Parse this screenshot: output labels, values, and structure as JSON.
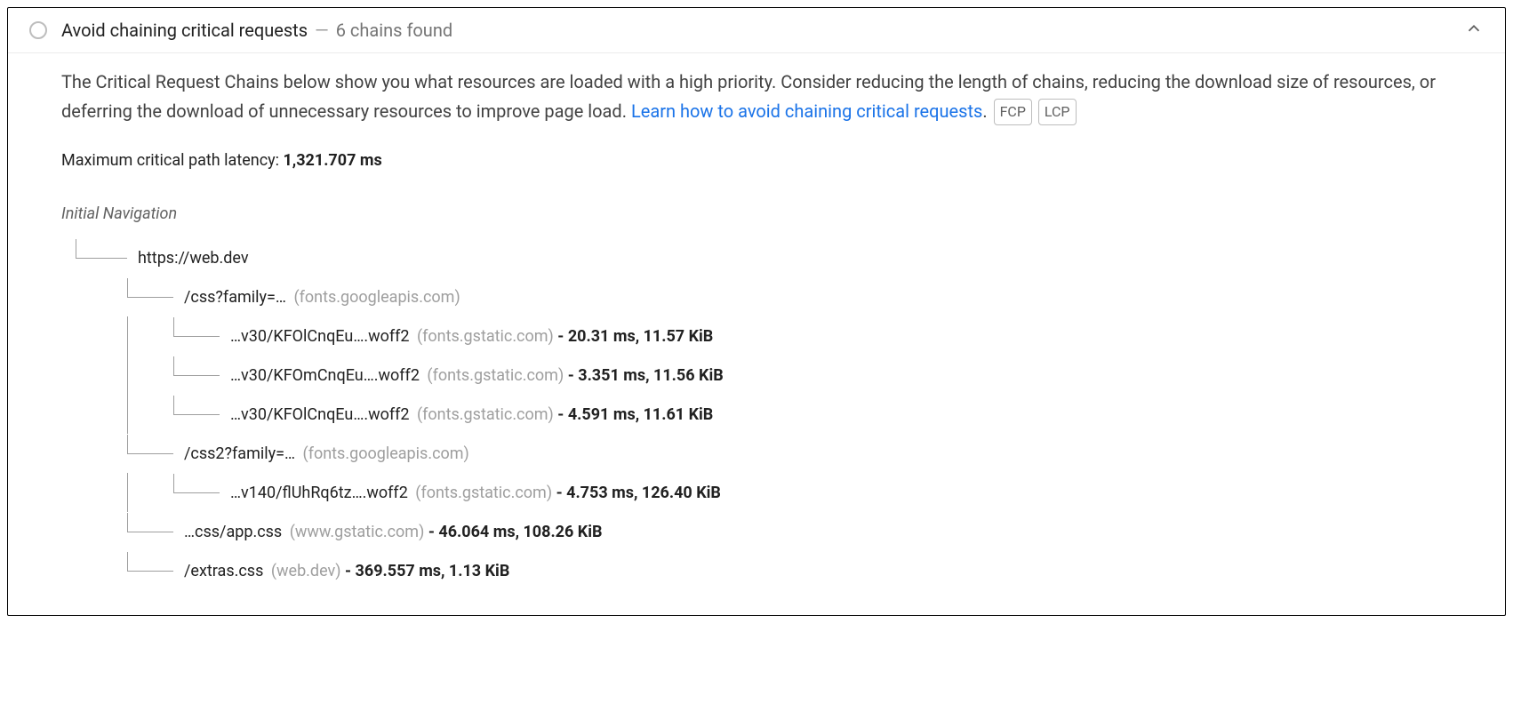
{
  "header": {
    "title": "Avoid chaining critical requests",
    "summary": "6 chains found"
  },
  "description": {
    "text_before_link": "The Critical Request Chains below show you what resources are loaded with a high priority. Consider reducing the length of chains, reducing the download size of resources, or deferring the download of unnecessary resources to improve page load. ",
    "link_text": "Learn how to avoid chaining critical requests",
    "text_after_link": ".",
    "badges": [
      "FCP",
      "LCP"
    ]
  },
  "latency": {
    "label": "Maximum critical path latency: ",
    "value": "1,321.707 ms"
  },
  "tree": {
    "root_label": "Initial Navigation",
    "root_url": "https://web.dev",
    "children": [
      {
        "url": "/css?family=…",
        "origin": "(fonts.googleapis.com)",
        "stats": "",
        "children": [
          {
            "url": "…v30/KFOlCnqEu….woff2",
            "origin": "(fonts.gstatic.com)",
            "stats": "- 20.31 ms, 11.57 KiB"
          },
          {
            "url": "…v30/KFOmCnqEu….woff2",
            "origin": "(fonts.gstatic.com)",
            "stats": "- 3.351 ms, 11.56 KiB"
          },
          {
            "url": "…v30/KFOlCnqEu….woff2",
            "origin": "(fonts.gstatic.com)",
            "stats": "- 4.591 ms, 11.61 KiB"
          }
        ]
      },
      {
        "url": "/css2?family=…",
        "origin": "(fonts.googleapis.com)",
        "stats": "",
        "children": [
          {
            "url": "…v140/flUhRq6tz….woff2",
            "origin": "(fonts.gstatic.com)",
            "stats": "- 4.753 ms, 126.40 KiB"
          }
        ]
      },
      {
        "url": "…css/app.css",
        "origin": "(www.gstatic.com)",
        "stats": "- 46.064 ms, 108.26 KiB",
        "children": []
      },
      {
        "url": "/extras.css",
        "origin": "(web.dev)",
        "stats": "- 369.557 ms, 1.13 KiB",
        "children": []
      }
    ]
  }
}
